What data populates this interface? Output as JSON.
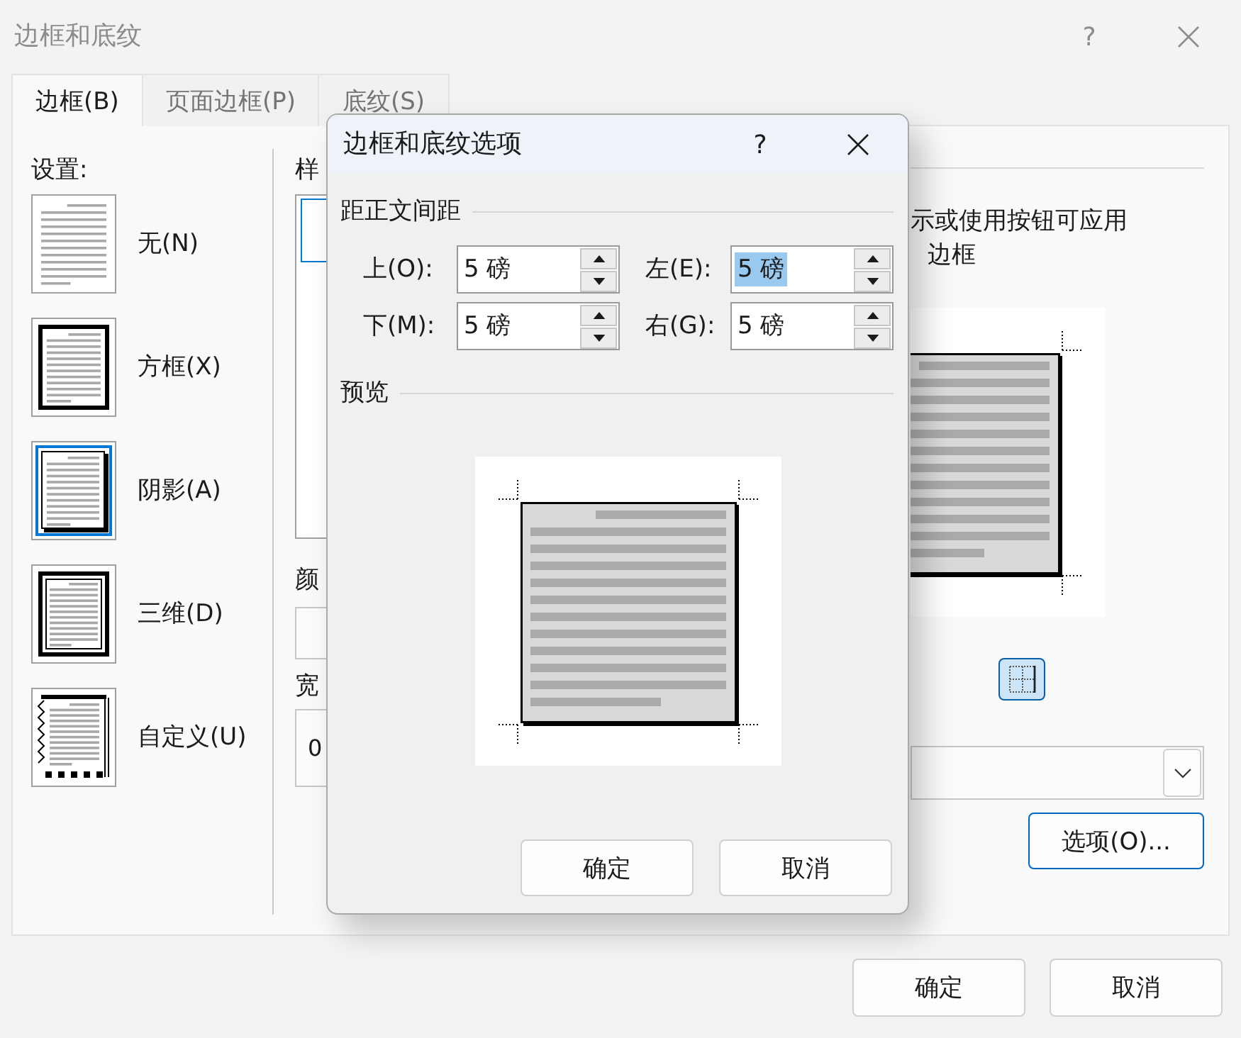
{
  "window": {
    "title": "边框和底纹",
    "help_label": "?"
  },
  "tabs": [
    {
      "label": "边框(B)",
      "selected": true
    },
    {
      "label": "页面边框(P)",
      "selected": false
    },
    {
      "label": "底纹(S)",
      "selected": false
    }
  ],
  "settings": {
    "heading": "设置:",
    "items": [
      {
        "kind": "none",
        "label": "无(N)",
        "selected": false
      },
      {
        "kind": "box",
        "label": "方框(X)",
        "selected": false
      },
      {
        "kind": "shadow",
        "label": "阴影(A)",
        "selected": true
      },
      {
        "kind": "threed",
        "label": "三维(D)",
        "selected": false
      },
      {
        "kind": "custom",
        "label": "自定义(U)",
        "selected": false
      }
    ]
  },
  "style": {
    "heading": "样",
    "list_items": [
      {
        "selected": true
      }
    ]
  },
  "color": {
    "heading": "颜"
  },
  "width": {
    "heading": "宽",
    "value": "0"
  },
  "preview": {
    "hint": "示或使用按钮可应用边框",
    "border_buttons": [
      {
        "pressed": true
      }
    ]
  },
  "options_button": {
    "label": "选项(O)...",
    "focused": true
  },
  "buttons": [
    {
      "label": "确定"
    },
    {
      "label": "取消"
    }
  ],
  "options_dialog": {
    "title": "边框和底纹选项",
    "help_label": "?",
    "spacing": {
      "heading": "距正文间距",
      "fields": [
        {
          "label": "上(O):",
          "value": "5 磅",
          "highlighted": false
        },
        {
          "label": "左(E):",
          "value": "5 磅",
          "highlighted": true
        },
        {
          "label": "下(M):",
          "value": "5 磅",
          "highlighted": false
        },
        {
          "label": "右(G):",
          "value": "5 磅",
          "highlighted": false
        }
      ]
    },
    "preview_heading": "预览",
    "buttons": [
      {
        "label": "确定"
      },
      {
        "label": "取消"
      }
    ]
  }
}
